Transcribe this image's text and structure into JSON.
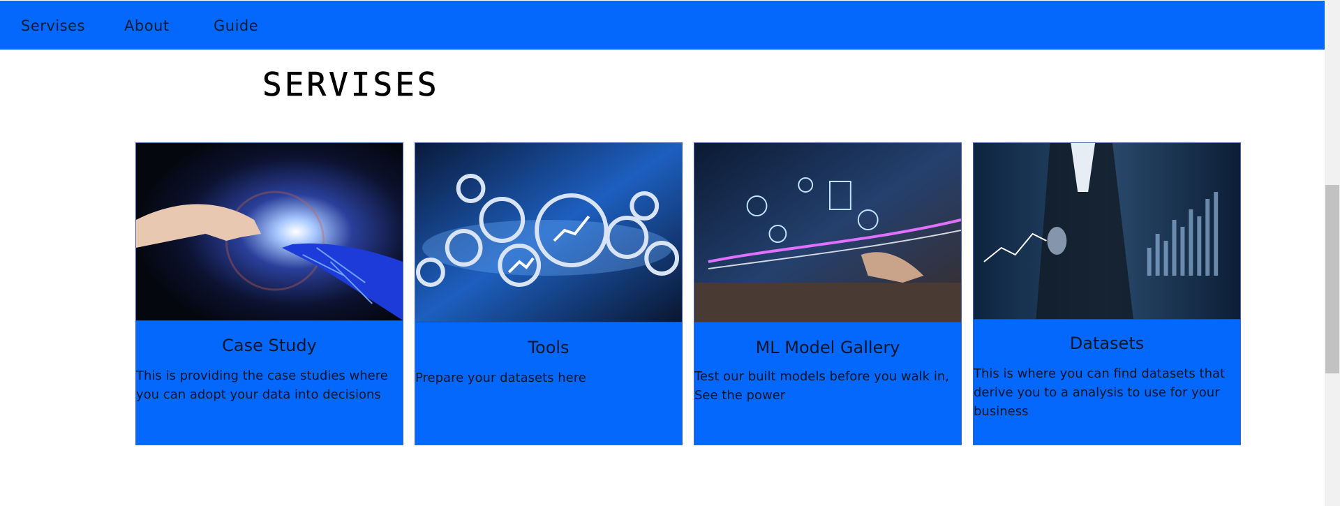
{
  "nav": {
    "items": [
      {
        "label": "Servises"
      },
      {
        "label": "About"
      },
      {
        "label": "Guide"
      }
    ]
  },
  "page": {
    "title": "SERVISES"
  },
  "cards": [
    {
      "title": "Case Study",
      "description": "This is providing the case studies where you can adopt your data into decisions",
      "image_icon": "hand-touching-robot-hand-image"
    },
    {
      "title": "Tools",
      "description": "Prepare your datasets here",
      "image_icon": "gears-analytics-image"
    },
    {
      "title": "ML Model Gallery",
      "description": "Test our built models before you walk in, See the power",
      "image_icon": "hand-holographic-interface-image"
    },
    {
      "title": "Datasets",
      "description": "This is where you can find datasets that derive you to a analysis to use for your business",
      "image_icon": "businessman-data-charts-image"
    }
  ],
  "colors": {
    "nav_bg": "#0468fd",
    "card_bg": "#0468fd",
    "text": "#07152a"
  }
}
